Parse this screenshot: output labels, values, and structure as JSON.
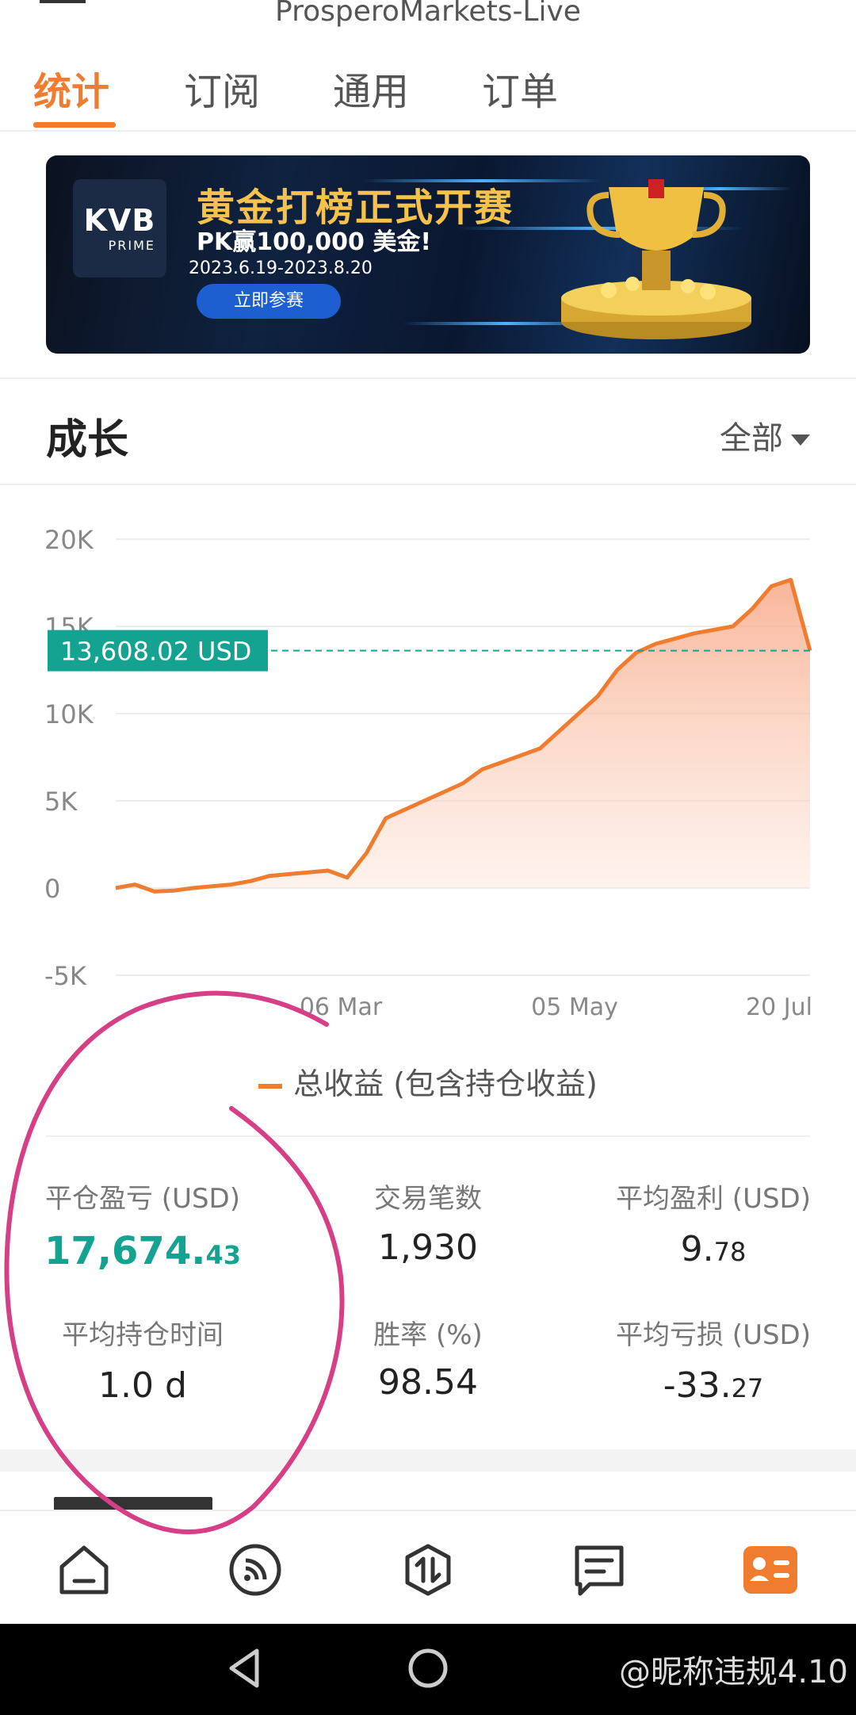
{
  "header": {
    "app_title": "ProsperoMarkets-Live"
  },
  "tabs": [
    {
      "label": "统计",
      "active": true
    },
    {
      "label": "订阅",
      "active": false
    },
    {
      "label": "通用",
      "active": false
    },
    {
      "label": "订单",
      "active": false
    }
  ],
  "banner": {
    "logo_main": "KVB",
    "logo_sub": "PRIME",
    "title": "黄金打榜正式开赛",
    "subtitle": "PK赢100,000 美金!",
    "dates": "2023.6.19-2023.8.20",
    "button": "立即参赛"
  },
  "growth": {
    "title": "成长",
    "filter": "全部"
  },
  "chart_data": {
    "type": "area",
    "y_ticks": [
      "20K",
      "15K",
      "10K",
      "5K",
      "0",
      "-5K"
    ],
    "ylim": [
      -5000,
      20000
    ],
    "x_ticks": [
      "06 Mar",
      "05 May",
      "20 Jul"
    ],
    "series": [
      {
        "name": "总收益 (包含持仓收益)",
        "color": "#f07c30",
        "values": [
          0,
          200,
          -200,
          -150,
          0,
          100,
          200,
          400,
          700,
          800,
          900,
          1000,
          600,
          2000,
          4000,
          4500,
          5000,
          5500,
          6000,
          6800,
          7200,
          7600,
          8000,
          9000,
          10000,
          11000,
          12500,
          13500,
          14000,
          14300,
          14600,
          14800,
          15000,
          16000,
          17300,
          17674,
          13608
        ]
      }
    ],
    "marker": {
      "value": 13608.02,
      "label": "13,608.02 USD",
      "color": "#14a391"
    }
  },
  "legend": {
    "label": "总收益 (包含持仓收益)"
  },
  "stats": {
    "closed_pnl_label": "平仓盈亏 (USD)",
    "closed_pnl_int": "17,674.",
    "closed_pnl_dec": "43",
    "trades_label": "交易笔数",
    "trades_value": "1,930",
    "avg_profit_label": "平均盈利 (USD)",
    "avg_profit_int": "9.",
    "avg_profit_dec": "78",
    "avg_hold_label": "平均持仓时间",
    "avg_hold_value": "1.0 d",
    "win_rate_label": "胜率 (%)",
    "win_rate_value": "98.54",
    "avg_loss_label": "平均亏损 (USD)",
    "avg_loss_int": "-33.",
    "avg_loss_dec": "27"
  },
  "bottom_nav": [
    {
      "icon": "home-icon"
    },
    {
      "icon": "feed-icon"
    },
    {
      "icon": "trade-icon"
    },
    {
      "icon": "message-icon"
    },
    {
      "icon": "profile-card-icon",
      "active": true
    }
  ],
  "watermark": "@昵称违规4.10",
  "colors": {
    "accent": "#f07c30",
    "profit": "#14a391",
    "annotation": "#d63f86"
  }
}
